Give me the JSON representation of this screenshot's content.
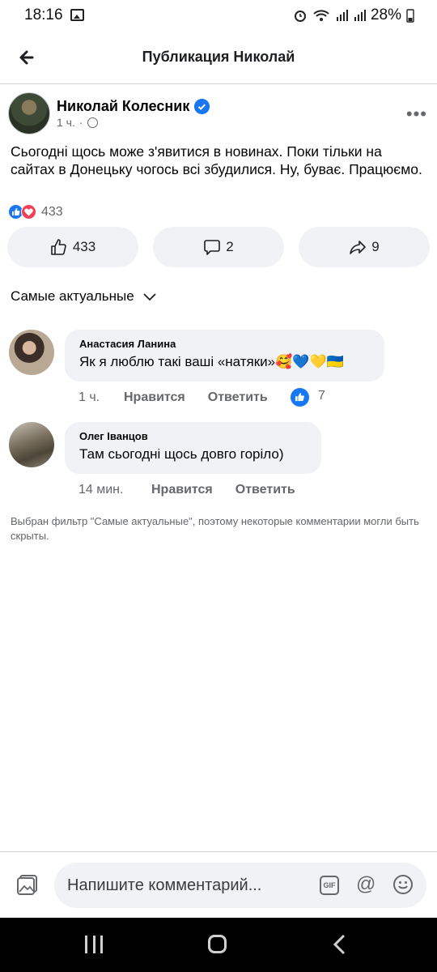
{
  "status": {
    "time": "18:16",
    "battery": "28%"
  },
  "header": {
    "title": "Публикация Николай"
  },
  "post": {
    "author": "Николай Колесник",
    "time": "1 ч.",
    "text": "Сьогодні щось може з'явитися в новинах. Поки тільки на сайтах в Донецьку чогось всі збудилися. Ну, буває.   Працюємо.",
    "reaction_count": "433",
    "actions": {
      "like": "433",
      "comment": "2",
      "share": "9"
    }
  },
  "sort": {
    "label": "Самые актуальные"
  },
  "comments": [
    {
      "author": "Анастасия Ланина",
      "text": "Як я люблю такі ваші «натяки»🥰💙💛🇺🇦",
      "time": "1 ч.",
      "like": "Нравится",
      "reply": "Ответить",
      "reactions": "7"
    },
    {
      "author": "Олег Іванцов",
      "text": "Там сьогодні щось довго горіло)",
      "time": "14 мин.",
      "like": "Нравится",
      "reply": "Ответить"
    }
  ],
  "filter_note": "Выбран фильтр \"Самые актуальные\", поэтому некоторые комментарии могли быть скрыты.",
  "composer": {
    "placeholder": "Напишите комментарий..."
  },
  "colors": {
    "accent": "#1877f2",
    "love": "#f33e58",
    "bubble": "#f0f2f5",
    "muted": "#65676b"
  },
  "icons": [
    "back-arrow-icon",
    "verified-icon",
    "globe-icon",
    "more-icon",
    "like-icon",
    "comment-icon",
    "share-icon",
    "chevron-down-icon",
    "photo-icon",
    "gif-icon",
    "mention-icon",
    "emoji-icon"
  ]
}
